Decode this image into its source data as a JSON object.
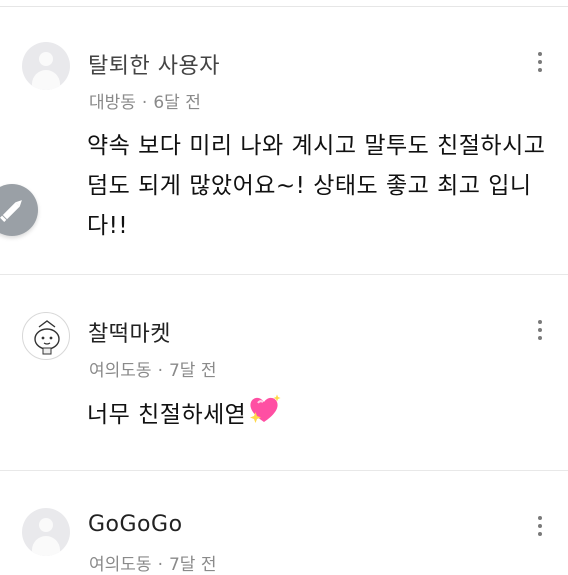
{
  "reviews": [
    {
      "author": "탈퇴한 사용자",
      "location": "대방동",
      "time": "6달 전",
      "text": "약속 보다 미리 나와 계시고 말투도 친절하시고 덤도 되게 많았어요~! 상태도 좋고 최고 입니다!!"
    },
    {
      "author": "찰떡마켓",
      "location": "여의도동",
      "time": "7달 전",
      "text": "너무 친절하세엳"
    },
    {
      "author": "GoGoGo",
      "location": "여의도동",
      "time": "7달 전"
    }
  ],
  "icons": {
    "kebab": "more-vertical-icon",
    "fab": "pencil-icon",
    "heart": "sparkling-heart-icon"
  },
  "colors": {
    "accent_heart": "#ff4fa3",
    "fab": "#9aa0a6"
  }
}
